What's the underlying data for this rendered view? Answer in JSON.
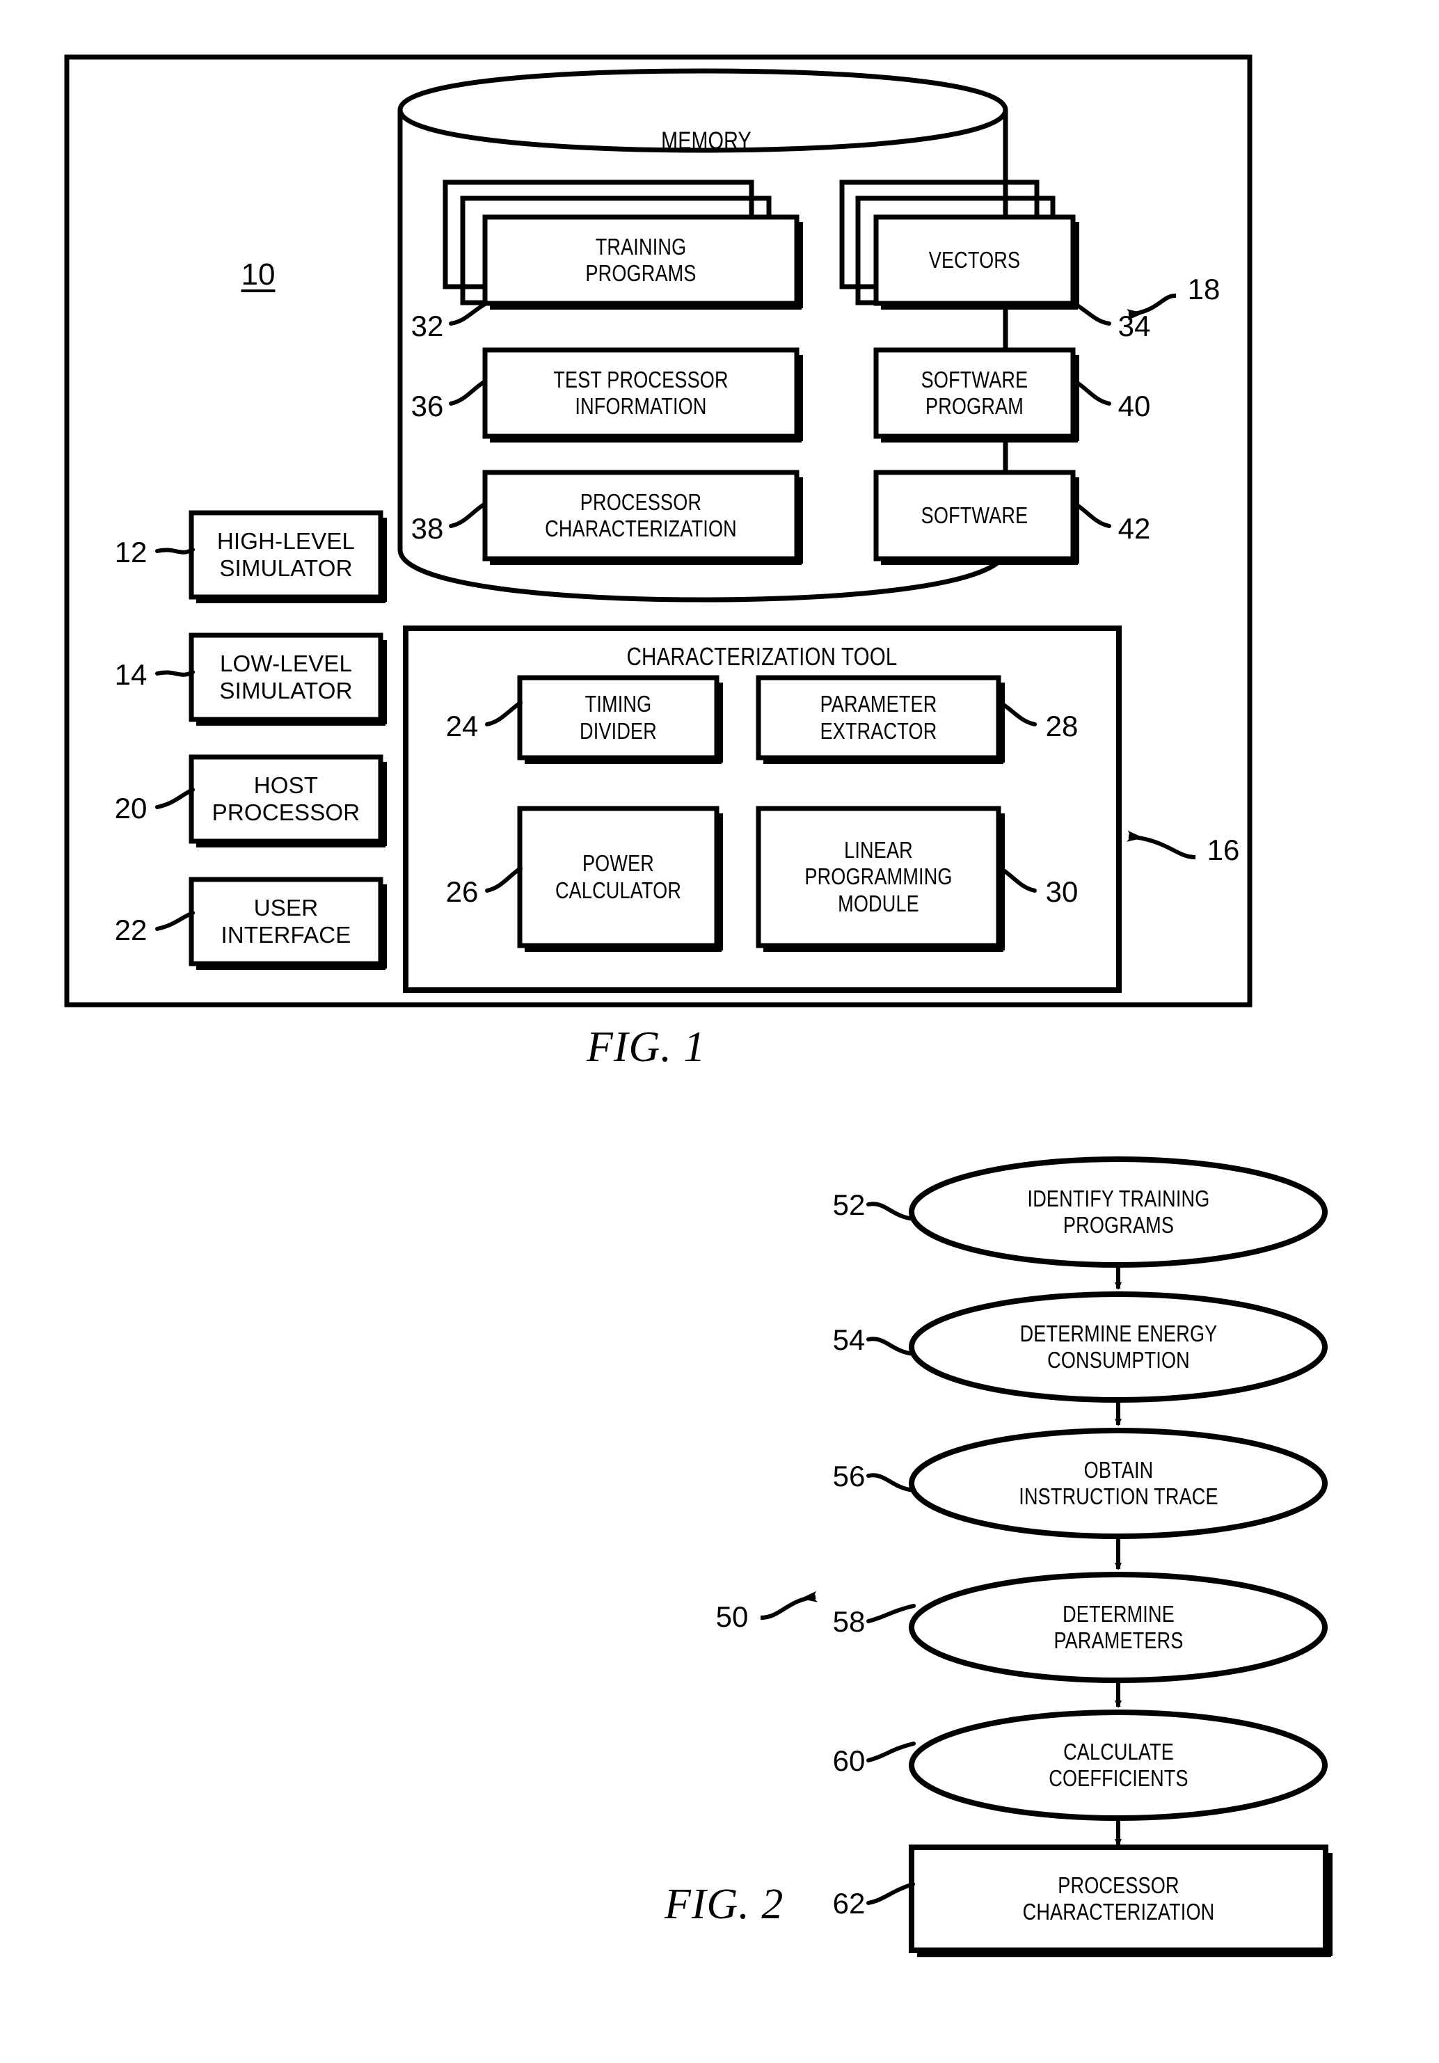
{
  "figures": [
    {
      "caption": "FIG. 1",
      "system_ref": "10",
      "memory": {
        "title": "MEMORY",
        "ref": "18",
        "items": [
          {
            "label": "TRAINING\nPROGRAMS",
            "ref": "32",
            "stacked": true
          },
          {
            "label": "VECTORS",
            "ref": "34",
            "stacked": true
          },
          {
            "label": "TEST PROCESSOR\nINFORMATION",
            "ref": "36",
            "stacked": false
          },
          {
            "label": "SOFTWARE\nPROGRAM",
            "ref": "40",
            "stacked": false
          },
          {
            "label": "PROCESSOR\nCHARACTERIZATION",
            "ref": "38",
            "stacked": false
          },
          {
            "label": "SOFTWARE",
            "ref": "42",
            "stacked": false
          }
        ]
      },
      "characterization_tool": {
        "title": "CHARACTERIZATION TOOL",
        "ref": "16",
        "items": [
          {
            "label": "TIMING\nDIVIDER",
            "ref": "24"
          },
          {
            "label": "PARAMETER\nEXTRACTOR",
            "ref": "28"
          },
          {
            "label": "POWER\nCALCULATOR",
            "ref": "26"
          },
          {
            "label": "LINEAR\nPROGRAMMING\nMODULE",
            "ref": "30"
          }
        ]
      },
      "left_column": [
        {
          "label": "HIGH-LEVEL\nSIMULATOR",
          "ref": "12"
        },
        {
          "label": "LOW-LEVEL\nSIMULATOR",
          "ref": "14"
        },
        {
          "label": "HOST\nPROCESSOR",
          "ref": "20"
        },
        {
          "label": "USER\nINTERFACE",
          "ref": "22"
        }
      ]
    },
    {
      "caption": "FIG. 2",
      "flow_ref": "50",
      "steps": [
        {
          "label": "IDENTIFY TRAINING\nPROGRAMS",
          "ref": "52",
          "shape": "ellipse"
        },
        {
          "label": "DETERMINE ENERGY\nCONSUMPTION",
          "ref": "54",
          "shape": "ellipse"
        },
        {
          "label": "OBTAIN\nINSTRUCTION TRACE",
          "ref": "56",
          "shape": "ellipse"
        },
        {
          "label": "DETERMINE\nPARAMETERS",
          "ref": "58",
          "shape": "ellipse"
        },
        {
          "label": "CALCULATE\nCOEFFICIENTS",
          "ref": "60",
          "shape": "ellipse"
        },
        {
          "label": "PROCESSOR\nCHARACTERIZATION",
          "ref": "62",
          "shape": "rect"
        }
      ]
    }
  ]
}
